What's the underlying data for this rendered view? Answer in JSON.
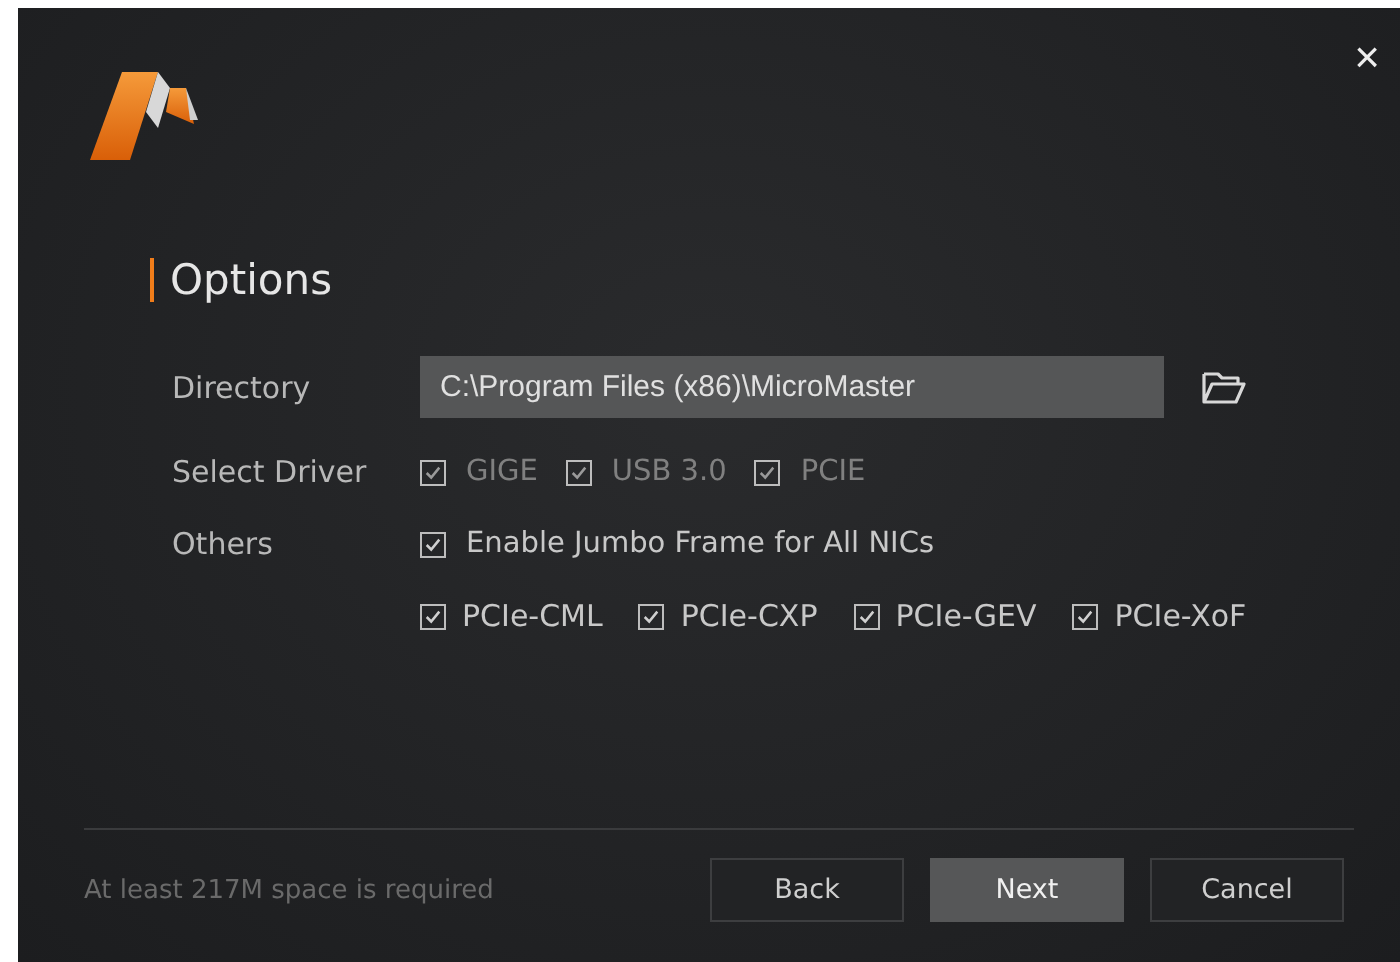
{
  "title": "Options",
  "directory": {
    "label": "Directory",
    "value": "C:\\Program Files (x86)\\MicroMaster"
  },
  "select_driver": {
    "label": "Select Driver",
    "options": [
      {
        "label": "GIGE",
        "checked": true,
        "disabled": true
      },
      {
        "label": "USB 3.0",
        "checked": true,
        "disabled": true
      },
      {
        "label": "PCIE",
        "checked": true,
        "disabled": true
      }
    ]
  },
  "others": {
    "label": "Others",
    "options": [
      {
        "label": "Enable Jumbo Frame for All NICs",
        "checked": true,
        "disabled": false
      }
    ],
    "pcie_options": [
      {
        "label": "PCIe-CML",
        "checked": true,
        "disabled": false
      },
      {
        "label": "PCIe-CXP",
        "checked": true,
        "disabled": false
      },
      {
        "label": "PCIe-GEV",
        "checked": true,
        "disabled": false
      },
      {
        "label": "PCIe-XoF",
        "checked": true,
        "disabled": false
      }
    ]
  },
  "footer_note": "At least 217M space is required",
  "buttons": [
    {
      "label": "Back",
      "kind": "default"
    },
    {
      "label": "Next",
      "kind": "primary"
    },
    {
      "label": "Cancel",
      "kind": "default"
    }
  ],
  "close_label": "×"
}
